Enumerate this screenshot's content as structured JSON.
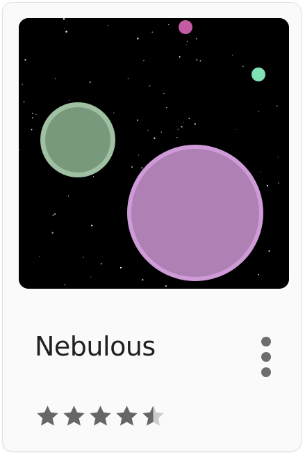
{
  "app": {
    "name": "Nebulous",
    "rating": 4.5,
    "rating_max": 5
  },
  "icons": {
    "menu": "more-vert-icon",
    "star": "star-icon",
    "half_star": "star-half-icon"
  },
  "colors": {
    "card_background": "#fafafa",
    "art_background": "#000000",
    "green_blob": "#79997c",
    "green_blob_ring": "#9fc1a2",
    "purple_blob": "#ae80b4",
    "purple_blob_ring": "#cf9ad8",
    "pink_dot": "#c45ca4",
    "mint_dot": "#7fe2b4",
    "star_filled": "#666666",
    "star_empty": "#cccccc",
    "title_text": "#202020",
    "menu_dots": "#6d6d6d"
  }
}
